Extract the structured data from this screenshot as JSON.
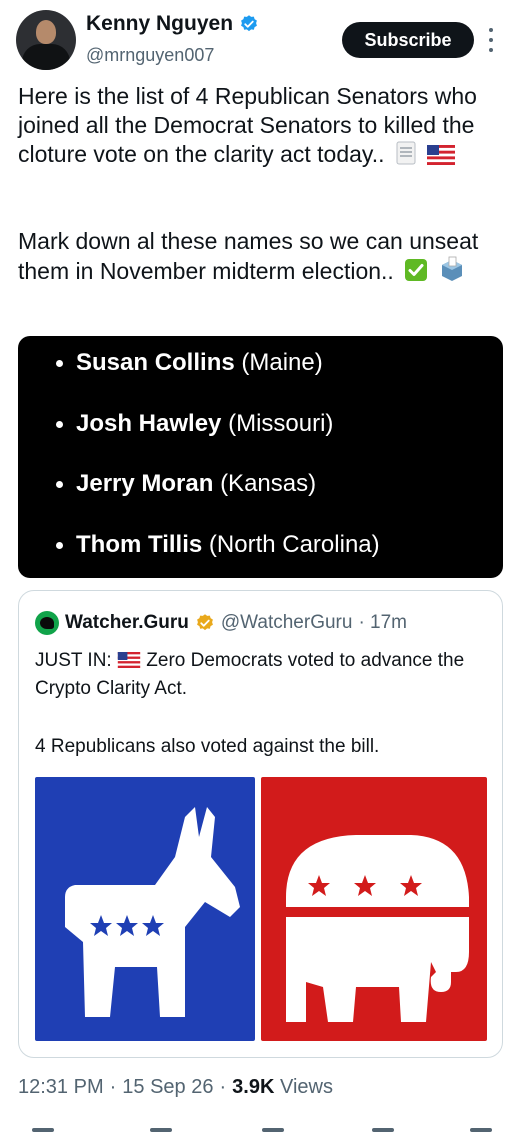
{
  "author": {
    "name": "Kenny Nguyen",
    "handle": "@mrnguyen007",
    "verified_icon": "verified-badge-icon",
    "badge_color": "#1d9bf0"
  },
  "actions": {
    "subscribe_label": "Subscribe",
    "more_icon": "more-vertical-icon"
  },
  "post": {
    "paragraph1": "Here is the list of 4 Republican Senators who joined all the Democrat Senators to killed the cloture vote on the clarity act today..",
    "paragraph1_emojis": [
      "page-icon",
      "us-flag-icon"
    ],
    "paragraph2": "Mark down al these names so we can unseat them in November midterm election..",
    "paragraph2_emojis": [
      "check-mark-icon",
      "ballot-box-icon"
    ]
  },
  "senators": [
    {
      "name": "Susan Collins",
      "state": "(Maine)"
    },
    {
      "name": "Josh Hawley",
      "state": "(Missouri)"
    },
    {
      "name": "Jerry Moran",
      "state": "(Kansas)"
    },
    {
      "name": "Thom Tillis",
      "state": "(North Carolina)"
    }
  ],
  "quote": {
    "name": "Watcher.Guru",
    "handle": "@WatcherGuru",
    "time": "· 17m",
    "line1_prefix": "JUST IN:",
    "line1_rest": "Zero Democrats voted to advance the Crypto Clarity Act.",
    "line2": "4 Republicans also voted against the bill.",
    "badge_color": "#e9a91c",
    "images": [
      "democrat-donkey-image",
      "republican-elephant-image"
    ],
    "colors": {
      "blue": "#1f3fb4",
      "red": "#d21b1b"
    }
  },
  "footer": {
    "time": "12:31 PM",
    "date": "15 Sep 26",
    "views_count": "3.9K",
    "views_label": "Views",
    "separator": "·"
  }
}
